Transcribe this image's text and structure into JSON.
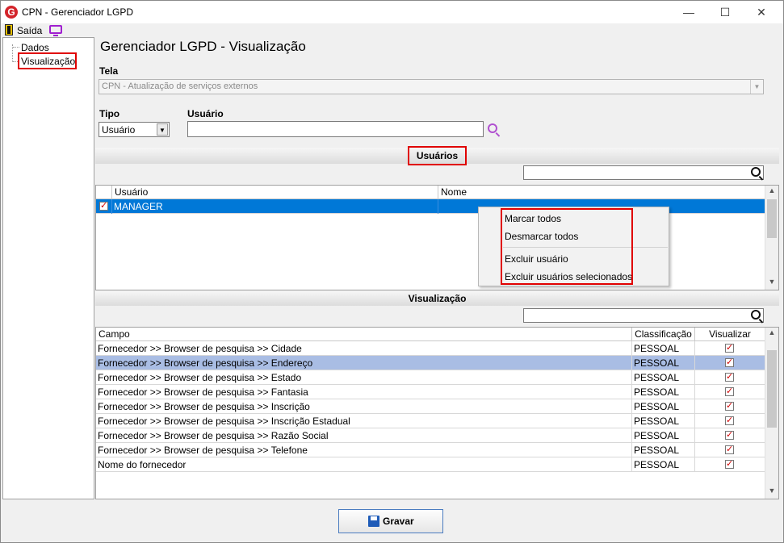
{
  "window": {
    "title": "CPN - Gerenciador LGPD",
    "logo": "G",
    "minimize": "—",
    "maximize": "☐",
    "close": "✕"
  },
  "menu": {
    "exit_label": "Saída"
  },
  "tree": {
    "items": [
      {
        "label": "Dados"
      },
      {
        "label": "Visualização"
      }
    ]
  },
  "main": {
    "title": "Gerenciador LGPD - Visualização",
    "tela_label": "Tela",
    "tela_value": "CPN - Atualização de serviços externos",
    "tipo_label": "Tipo",
    "tipo_value": "Usuário",
    "usuario_label": "Usuário",
    "usuario_value": ""
  },
  "users_section": {
    "title": "Usuários",
    "columns": [
      "Usuário",
      "Nome"
    ],
    "rows": [
      {
        "checked": true,
        "usuario": "MANAGER",
        "nome": ""
      }
    ]
  },
  "context_menu": {
    "items": [
      "Marcar todos",
      "Desmarcar todos",
      "Excluir usuário",
      "Excluir usuários selecionados"
    ]
  },
  "view_section": {
    "title": "Visualização",
    "columns": [
      "Campo",
      "Classificação",
      "Visualizar"
    ],
    "rows": [
      {
        "campo": "Fornecedor >> Browser de pesquisa >> Cidade",
        "classificacao": "PESSOAL",
        "visualizar": true
      },
      {
        "campo": "Fornecedor >> Browser de pesquisa >> Endereço",
        "classificacao": "PESSOAL",
        "visualizar": true
      },
      {
        "campo": "Fornecedor >> Browser de pesquisa >> Estado",
        "classificacao": "PESSOAL",
        "visualizar": true
      },
      {
        "campo": "Fornecedor >> Browser de pesquisa >> Fantasia",
        "classificacao": "PESSOAL",
        "visualizar": true
      },
      {
        "campo": "Fornecedor >> Browser de pesquisa >> Inscrição",
        "classificacao": "PESSOAL",
        "visualizar": true
      },
      {
        "campo": "Fornecedor >> Browser de pesquisa >> Inscrição Estadual",
        "classificacao": "PESSOAL",
        "visualizar": true
      },
      {
        "campo": "Fornecedor >> Browser de pesquisa >> Razão Social",
        "classificacao": "PESSOAL",
        "visualizar": true
      },
      {
        "campo": "Fornecedor >> Browser de pesquisa >> Telefone",
        "classificacao": "PESSOAL",
        "visualizar": true
      },
      {
        "campo": "Nome do fornecedor",
        "classificacao": "PESSOAL",
        "visualizar": true
      }
    ]
  },
  "footer": {
    "save_label": "Gravar"
  },
  "colors": {
    "selection_blue": "#0078d7",
    "row_highlight": "#a9bde4",
    "annotation_red": "#e00000",
    "check_red": "#d00000"
  }
}
